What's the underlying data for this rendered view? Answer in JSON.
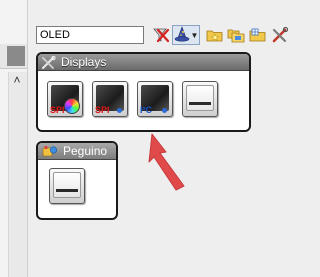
{
  "search": {
    "value": "OLED"
  },
  "toolbar": {
    "buttons": [
      {
        "name": "clear-filter",
        "icon": "red-x-filter-icon"
      },
      {
        "name": "filter-wizard",
        "icon": "wizard-hat-icon"
      },
      {
        "name": "folder-star",
        "icon": "folder-star-icon"
      },
      {
        "name": "folder-copy",
        "icon": "folder-copy-icon"
      },
      {
        "name": "folder-grid",
        "icon": "folder-grid-icon"
      },
      {
        "name": "tools",
        "icon": "tools-icon"
      }
    ]
  },
  "groups": {
    "displays": {
      "title": "Displays",
      "tiles": [
        {
          "label": "SPI",
          "icon": "oled-color-spi-icon"
        },
        {
          "label": "SPI",
          "icon": "oled-spi-icon"
        },
        {
          "label": "I²C",
          "icon": "oled-i2c-icon"
        },
        {
          "label": "",
          "icon": "display-module-icon"
        }
      ]
    },
    "peguino": {
      "title": "Peguino",
      "tiles": [
        {
          "label": "",
          "icon": "display-module-icon"
        }
      ]
    }
  },
  "colors": {
    "accent_red": "#e01818",
    "accent_blue": "#1b55c9",
    "annotation_arrow": "#e04a4a"
  }
}
